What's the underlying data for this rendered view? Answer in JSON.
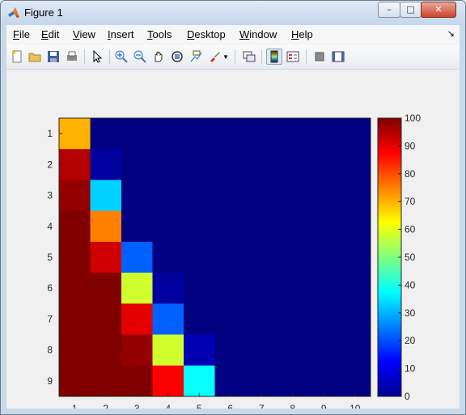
{
  "window": {
    "title": "Figure 1",
    "buttons": [
      "minimize",
      "maximize",
      "close"
    ]
  },
  "menu": [
    {
      "label": "File",
      "key": "F"
    },
    {
      "label": "Edit",
      "key": "E"
    },
    {
      "label": "View",
      "key": "V"
    },
    {
      "label": "Insert",
      "key": "I"
    },
    {
      "label": "Tools",
      "key": "T"
    },
    {
      "label": "Desktop",
      "key": "D"
    },
    {
      "label": "Window",
      "key": "W"
    },
    {
      "label": "Help",
      "key": "H"
    }
  ],
  "toolbar": {
    "icons": [
      "new-figure-icon",
      "open-file-icon",
      "save-icon",
      "print-icon",
      "edit-plot-arrow-icon",
      "zoom-in-icon",
      "zoom-out-icon",
      "pan-hand-icon",
      "rotate-3d-icon",
      "data-cursor-icon",
      "brush-icon",
      "brush-dropdown-icon",
      "link-plot-icon",
      "insert-colorbar-icon",
      "insert-legend-icon",
      "hide-plot-tools-icon",
      "show-plot-tools-icon"
    ]
  },
  "chart_data": {
    "type": "heatmap",
    "colormap": "jet",
    "x_ticks": [
      "1",
      "2",
      "3",
      "4",
      "5",
      "6",
      "7",
      "8",
      "9",
      "10"
    ],
    "y_ticks": [
      "1",
      "2",
      "3",
      "4",
      "5",
      "6",
      "7",
      "8",
      "9"
    ],
    "values": [
      [
        70,
        0,
        0,
        0,
        0,
        0,
        0,
        0,
        0,
        0
      ],
      [
        95,
        3,
        0,
        0,
        0,
        0,
        0,
        0,
        0,
        0
      ],
      [
        98,
        33,
        0,
        0,
        0,
        0,
        0,
        0,
        0,
        0
      ],
      [
        100,
        75,
        0,
        0,
        0,
        0,
        0,
        0,
        0,
        0
      ],
      [
        100,
        92,
        22,
        0,
        0,
        0,
        0,
        0,
        0,
        0
      ],
      [
        100,
        100,
        58,
        3,
        0,
        0,
        0,
        0,
        0,
        0
      ],
      [
        100,
        100,
        90,
        22,
        0,
        0,
        0,
        0,
        0,
        0
      ],
      [
        100,
        100,
        98,
        58,
        5,
        0,
        0,
        0,
        0,
        0
      ],
      [
        100,
        100,
        100,
        88,
        38,
        0,
        0,
        0,
        0,
        0
      ]
    ],
    "colorbar": {
      "range": [
        0,
        100
      ],
      "ticks": [
        "0",
        "10",
        "20",
        "30",
        "40",
        "50",
        "60",
        "70",
        "80",
        "90",
        "100"
      ]
    }
  }
}
